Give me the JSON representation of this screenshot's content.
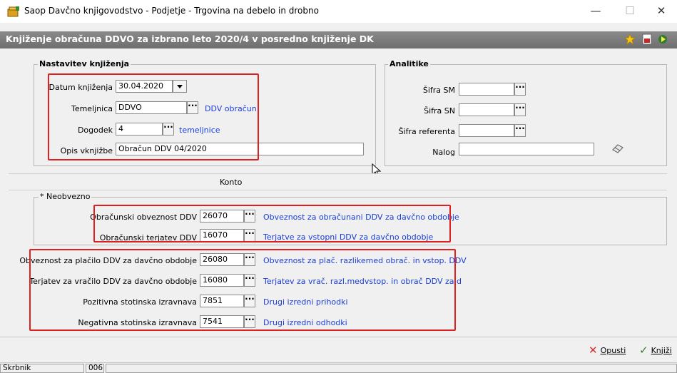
{
  "window": {
    "title": "Saop Davčno knjigovodstvo - Podjetje - Trgovina na debelo in drobno",
    "minimize": "—",
    "maximize": "☐",
    "close": "✕"
  },
  "header": {
    "title": "Knjiženje obračuna DDVO za izbrano leto 2020/4 v posredno knjiženje DK",
    "icons": [
      "star-icon",
      "pdf-icon",
      "run-icon"
    ]
  },
  "nastavitev": {
    "legend": "Nastavitev knjiženja",
    "datum_label": "Datum knjiženja",
    "datum_value": "30.04.2020",
    "temeljnica_label": "Temeljnica",
    "temeljnica_value": "DDVO",
    "temeljnica_link": "DDV obračun",
    "dogodek_label": "Dogodek",
    "dogodek_value": "4",
    "dogodek_link": "temeljnice",
    "opis_label": "Opis vknjižbe",
    "opis_value": "Obračun DDV 04/2020"
  },
  "analitike": {
    "legend": "Analitike",
    "sm_label": "Šifra SM",
    "sm_value": "",
    "sn_label": "Šifra SN",
    "sn_value": "",
    "ref_label": "Šifra referenta",
    "ref_value": "",
    "nalog_label": "Nalog",
    "nalog_value": ""
  },
  "konto": {
    "label": "Konto"
  },
  "neobvezno": {
    "legend": "* Neobvezno",
    "rows": [
      {
        "label": "Obračunski obveznost DDV",
        "value": "26070",
        "link": "Obveznost za obračunani  DDV za davčno obdobje"
      },
      {
        "label": "Obračunski terjatev DDV",
        "value": "16070",
        "link": "Terjatve za vstopni DDV   za davčno obdobje"
      }
    ]
  },
  "main_rows": [
    {
      "label": "Obveznost za plačilo DDV za davčno obdobje",
      "value": "26080",
      "link": "Obveznost za plač. razlikemed obrač. in vstop. DDV"
    },
    {
      "label": "Terjatev za vračilo DDV za davčno obdobje",
      "value": "16080",
      "link": "Terjatev za vrač. razl.medvstop. in obrač DDV za d"
    },
    {
      "label": "Pozitivna stotinska izravnava",
      "value": "7851",
      "link": "Drugi izredni prihodki"
    },
    {
      "label": "Negativna stotinska izravnava",
      "value": "7541",
      "link": "Drugi izredni odhodki"
    }
  ],
  "buttons": {
    "opusti": "Opusti",
    "knjizi": "Knjiži"
  },
  "status": {
    "user": "Skrbnik",
    "code": "006"
  },
  "colors": {
    "link": "#1a3fd6",
    "highlight": "#e02020",
    "header_bg": "#7a7a7a"
  }
}
